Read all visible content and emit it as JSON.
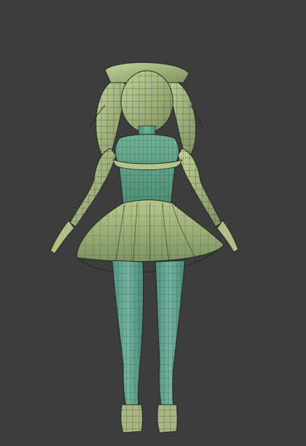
{
  "viewport": {
    "background_color": "#3d3d3d",
    "shading_mode": "solid-wireframe-overlay",
    "object": "character-model-rear-view"
  },
  "materials": {
    "hair_color": "#a9b97f",
    "dress_color": "#a4b67a",
    "bodice_color": "#5fa58b",
    "legs_color": "#6aa99c",
    "shoe_color": "#a9b683",
    "wire_color": "#1f2a1c"
  }
}
